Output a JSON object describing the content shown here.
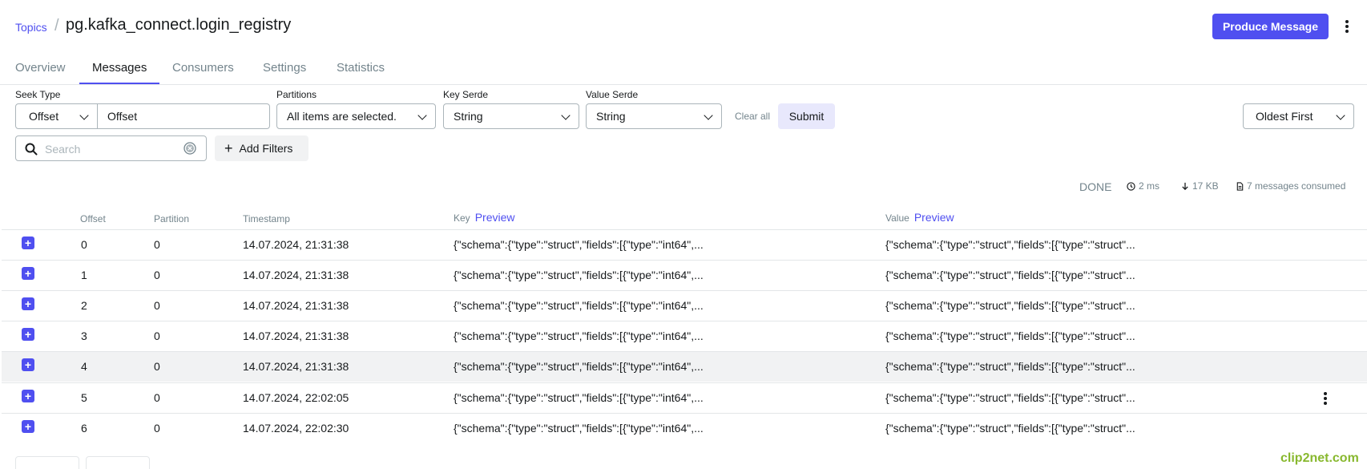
{
  "header": {
    "breadcrumb_link": "Topics",
    "breadcrumb_sep": "/",
    "title": "pg.kafka_connect.login_registry",
    "produce_button": "Produce Message"
  },
  "tabs": [
    "Overview",
    "Messages",
    "Consumers",
    "Settings",
    "Statistics"
  ],
  "active_tab": "Messages",
  "filters": {
    "seek_type": {
      "label": "Seek Type",
      "value": "Offset",
      "input_value": "Offset"
    },
    "partitions": {
      "label": "Partitions",
      "value": "All items are selected."
    },
    "key_serde": {
      "label": "Key Serde",
      "value": "String"
    },
    "value_serde": {
      "label": "Value Serde",
      "value": "String"
    },
    "clear_all": "Clear all",
    "submit": "Submit",
    "sort": "Oldest First",
    "search_placeholder": "Search",
    "add_filters": "Add Filters"
  },
  "status": {
    "state": "DONE",
    "time": "2 ms",
    "size": "17 KB",
    "consumed": "7 messages consumed"
  },
  "table": {
    "columns": {
      "offset": "Offset",
      "partition": "Partition",
      "timestamp": "Timestamp",
      "key": "Key",
      "value": "Value",
      "preview": "Preview"
    },
    "rows": [
      {
        "offset": "0",
        "partition": "0",
        "timestamp": "14.07.2024, 21:31:38",
        "key": "{\"schema\":{\"type\":\"struct\",\"fields\":[{\"type\":\"int64\",...",
        "value": "{\"schema\":{\"type\":\"struct\",\"fields\":[{\"type\":\"struct\"..."
      },
      {
        "offset": "1",
        "partition": "0",
        "timestamp": "14.07.2024, 21:31:38",
        "key": "{\"schema\":{\"type\":\"struct\",\"fields\":[{\"type\":\"int64\",...",
        "value": "{\"schema\":{\"type\":\"struct\",\"fields\":[{\"type\":\"struct\"..."
      },
      {
        "offset": "2",
        "partition": "0",
        "timestamp": "14.07.2024, 21:31:38",
        "key": "{\"schema\":{\"type\":\"struct\",\"fields\":[{\"type\":\"int64\",...",
        "value": "{\"schema\":{\"type\":\"struct\",\"fields\":[{\"type\":\"struct\"..."
      },
      {
        "offset": "3",
        "partition": "0",
        "timestamp": "14.07.2024, 21:31:38",
        "key": "{\"schema\":{\"type\":\"struct\",\"fields\":[{\"type\":\"int64\",...",
        "value": "{\"schema\":{\"type\":\"struct\",\"fields\":[{\"type\":\"struct\"..."
      },
      {
        "offset": "4",
        "partition": "0",
        "timestamp": "14.07.2024, 21:31:38",
        "key": "{\"schema\":{\"type\":\"struct\",\"fields\":[{\"type\":\"int64\",...",
        "value": "{\"schema\":{\"type\":\"struct\",\"fields\":[{\"type\":\"struct\"..."
      },
      {
        "offset": "5",
        "partition": "0",
        "timestamp": "14.07.2024, 22:02:05",
        "key": "{\"schema\":{\"type\":\"struct\",\"fields\":[{\"type\":\"int64\",...",
        "value": "{\"schema\":{\"type\":\"struct\",\"fields\":[{\"type\":\"struct\"..."
      },
      {
        "offset": "6",
        "partition": "0",
        "timestamp": "14.07.2024, 22:02:30",
        "key": "{\"schema\":{\"type\":\"struct\",\"fields\":[{\"type\":\"int64\",...",
        "value": "{\"schema\":{\"type\":\"struct\",\"fields\":[{\"type\":\"struct\"..."
      }
    ]
  },
  "watermark": "clip2net.com",
  "colors": {
    "accent": "#4f4ff0",
    "muted": "#73848c",
    "border": "#abb5ba"
  }
}
